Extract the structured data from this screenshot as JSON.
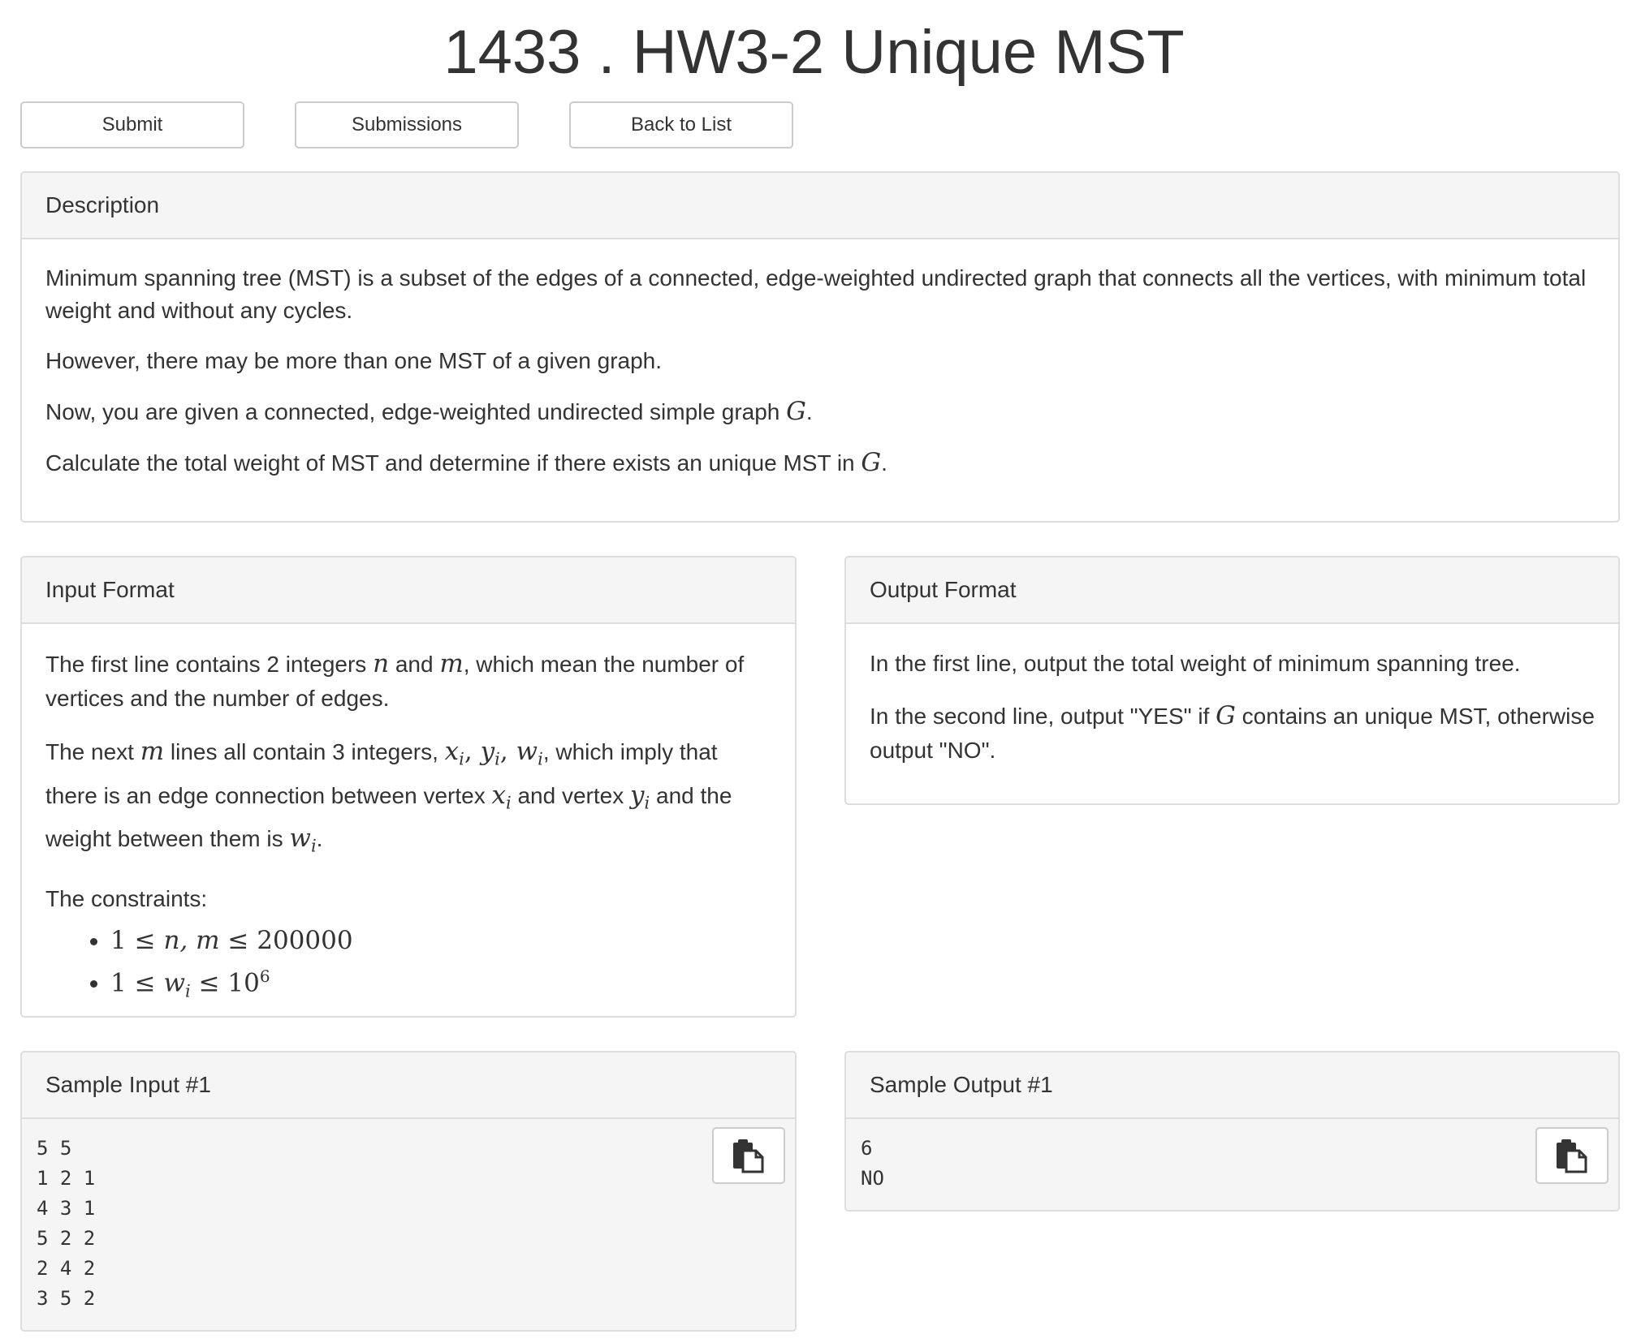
{
  "page": {
    "title": "1433 . HW3-2 Unique MST"
  },
  "toolbar": {
    "submit_label": "Submit",
    "submissions_label": "Submissions",
    "back_label": "Back to List"
  },
  "description": {
    "heading": "Description",
    "p1": "Minimum spanning tree (MST) is a subset of the edges of a connected, edge-weighted undirected graph that connects all the vertices, with minimum total weight and without any cycles.",
    "p2": "However, there may be more than one MST of a given graph.",
    "p3_text": "Now, you are given a connected, edge-weighted undirected simple graph ",
    "p3_var": "G",
    "p4_text": "Calculate the total weight of MST and determine if there exists an unique MST in ",
    "p4_var": "G"
  },
  "input_format": {
    "heading": "Input Format",
    "p1": {
      "t1": "The first line contains 2 integers ",
      "v1": "n",
      "t2": " and ",
      "v2": "m",
      "t3": ", which mean the number of vertices and the number of edges."
    },
    "p2": {
      "t1": "The next ",
      "v1": "m",
      "t2": " lines all contain 3 integers, ",
      "v2": "x",
      "v3": "y",
      "v4": "w",
      "sub": "i",
      "t3": ", which imply that there is an edge connection between vertex ",
      "t4": " and vertex ",
      "t5": " and the weight between them is "
    },
    "constraints_label": "The constraints:",
    "c1": {
      "a": "1",
      "rel": "≤",
      "vars": "n, m",
      "b": "200000"
    },
    "c2": {
      "a": "1",
      "rel": "≤",
      "var": "w",
      "sub": "i",
      "b": "10",
      "exp": "6"
    }
  },
  "output_format": {
    "heading": "Output Format",
    "p1": "In the first line, output the total weight of minimum spanning tree.",
    "p2_pre": "In the second line, output \"YES\" if ",
    "p2_var": "G",
    "p2_post": " contains an unique MST, otherwise output \"NO\"."
  },
  "sample_input": {
    "heading": "Sample Input #1",
    "text": "5 5\n1 2 1\n4 3 1\n5 2 2\n2 4 2\n3 5 2"
  },
  "sample_output": {
    "heading": "Sample Output #1",
    "text": "6\nNO"
  },
  "icons": {
    "copy": "clipboard-copy-icon"
  }
}
